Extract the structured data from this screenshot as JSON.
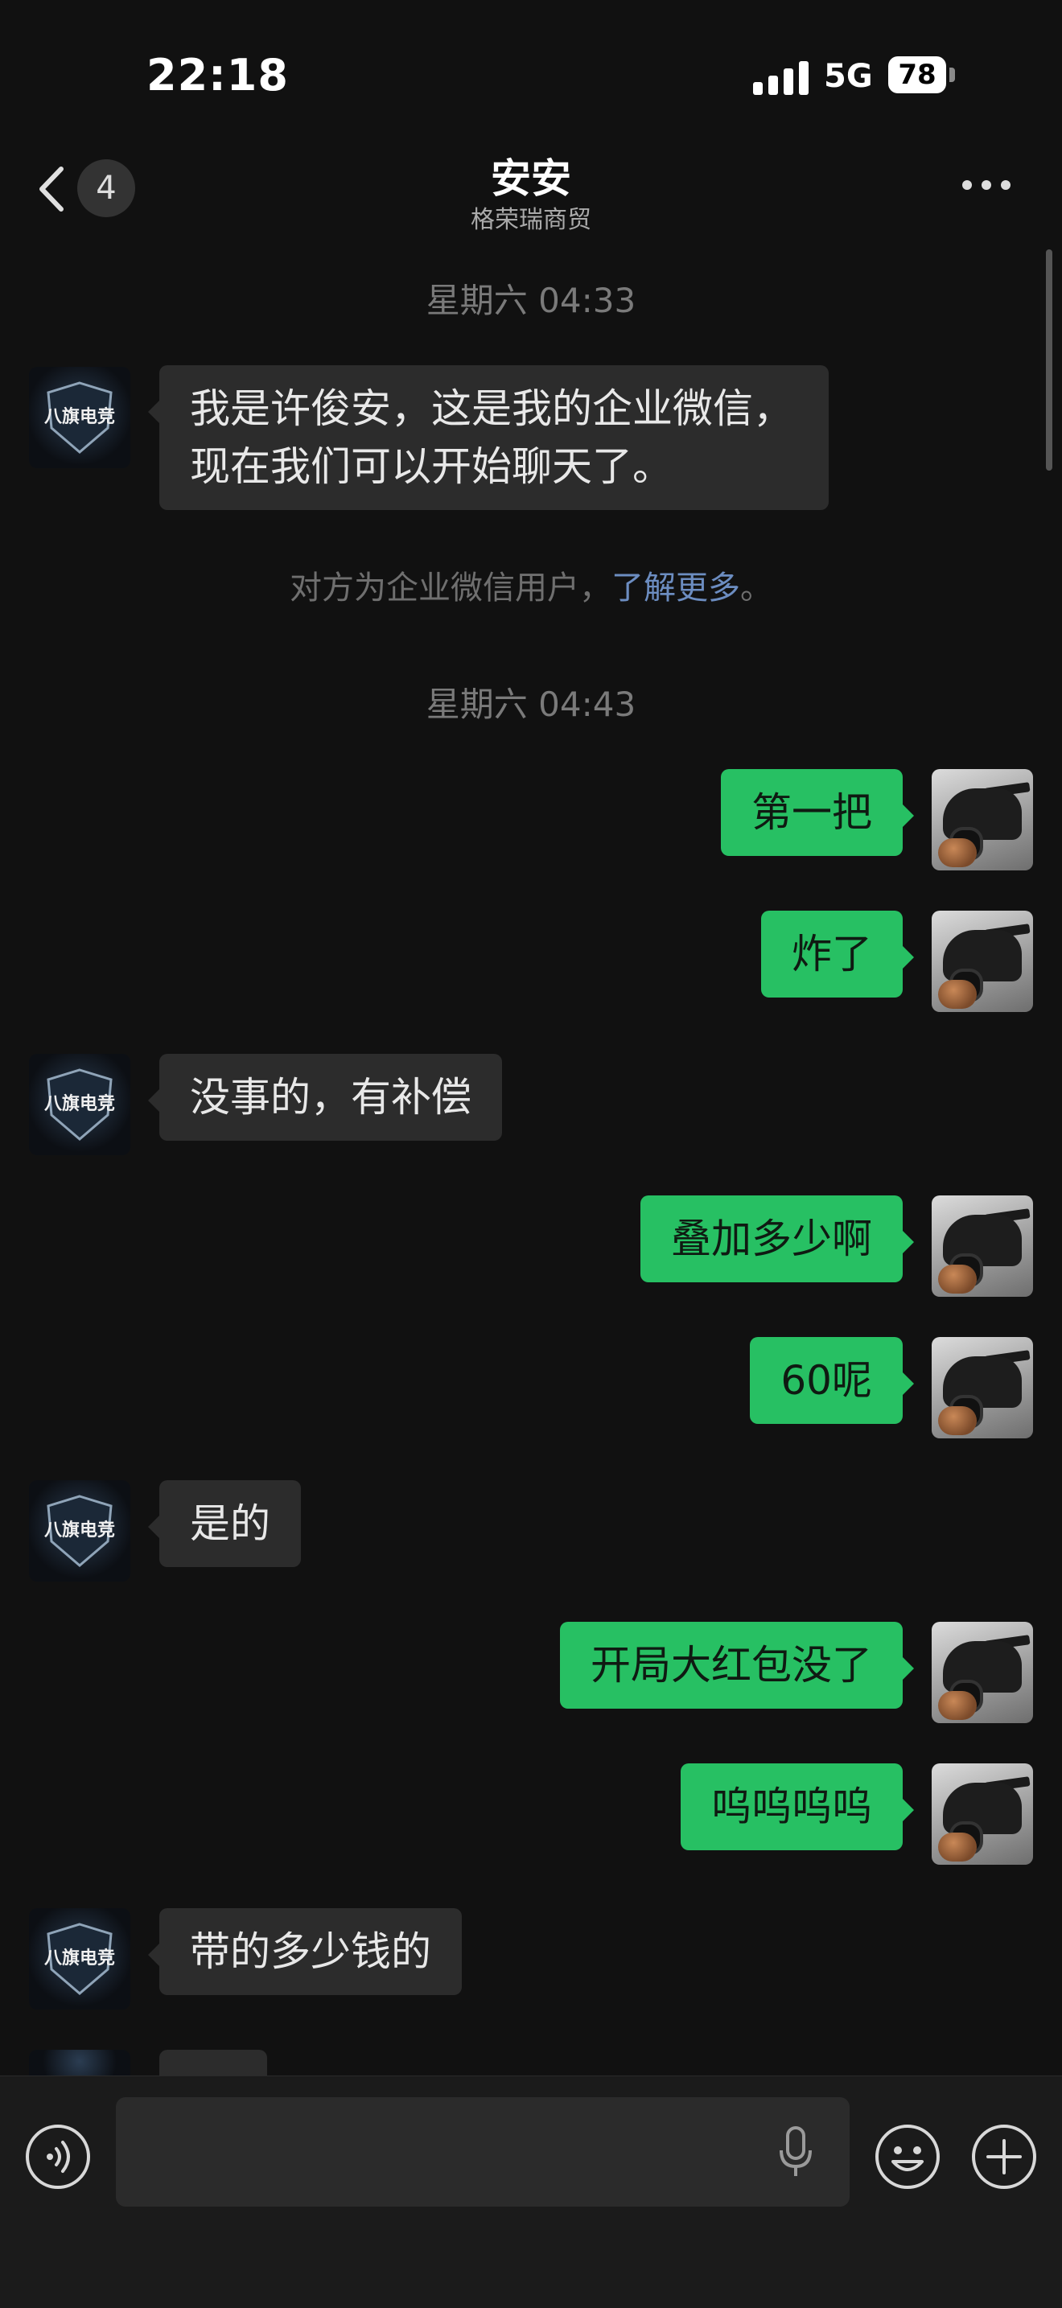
{
  "status_bar": {
    "time": "22:18",
    "network": "5G",
    "battery": "78"
  },
  "header": {
    "back_count": "4",
    "title": "安安",
    "subtitle": "格荣瑞商贸"
  },
  "chat": {
    "timestamps": [
      "星期六 04:33",
      "星期六 04:43"
    ],
    "system_notice": {
      "text": "对方为企业微信用户，",
      "link": "了解更多",
      "end": "。"
    },
    "avatar_logo_text": "八旗电竞",
    "messages": [
      {
        "side": "left",
        "lines": [
          "我是许俊安，这是我的企业微信，",
          "现在我们可以开始聊天了。"
        ]
      },
      {
        "side": "right",
        "text": "第一把"
      },
      {
        "side": "right",
        "text": "炸了"
      },
      {
        "side": "left",
        "text": "没事的，有补偿"
      },
      {
        "side": "right",
        "text": "叠加多少啊"
      },
      {
        "side": "right",
        "text": "60呢"
      },
      {
        "side": "left",
        "text": "是的"
      },
      {
        "side": "right",
        "text": "开局大红包没了"
      },
      {
        "side": "right",
        "text": "呜呜呜呜"
      },
      {
        "side": "left",
        "text": "带的多少钱的"
      }
    ]
  },
  "input_bar": {
    "placeholder": ""
  },
  "colors": {
    "background": "#111111",
    "incoming_bubble": "#2c2c2c",
    "outgoing_bubble": "#27c063",
    "link": "#6c8dc1"
  },
  "icons": [
    "chevron-left-icon",
    "more-icon",
    "voice-icon",
    "microphone-icon",
    "emoji-icon",
    "plus-icon"
  ]
}
